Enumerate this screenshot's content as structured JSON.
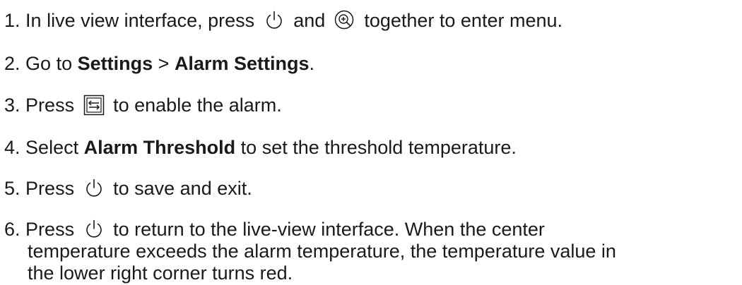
{
  "steps": [
    {
      "num": "1.",
      "t1": "In live view interface, press",
      "t2": "and",
      "t3": "together to enter menu.",
      "icon1": "power-icon",
      "icon2": "zoom-in-icon"
    },
    {
      "num": "2.",
      "t1": "Go to",
      "b1": "Settings",
      "t2": ">",
      "b2": "Alarm Settings",
      "t3": "."
    },
    {
      "num": "3.",
      "t1": "Press",
      "t2": "to enable the alarm.",
      "icon1": "mode-switch-icon"
    },
    {
      "num": "4.",
      "t1": "Select",
      "b1": "Alarm Threshold",
      "t2": "to set the threshold temperature."
    },
    {
      "num": "5.",
      "t1": "Press",
      "t2": "to save and exit.",
      "icon1": "power-icon"
    },
    {
      "num": "6.",
      "t1": "Press",
      "t2": "to return to the live-view interface. When the center",
      "line2": "temperature exceeds the alarm temperature, the temperature value in",
      "line3": "the lower right corner turns red.",
      "icon1": "power-icon"
    }
  ]
}
